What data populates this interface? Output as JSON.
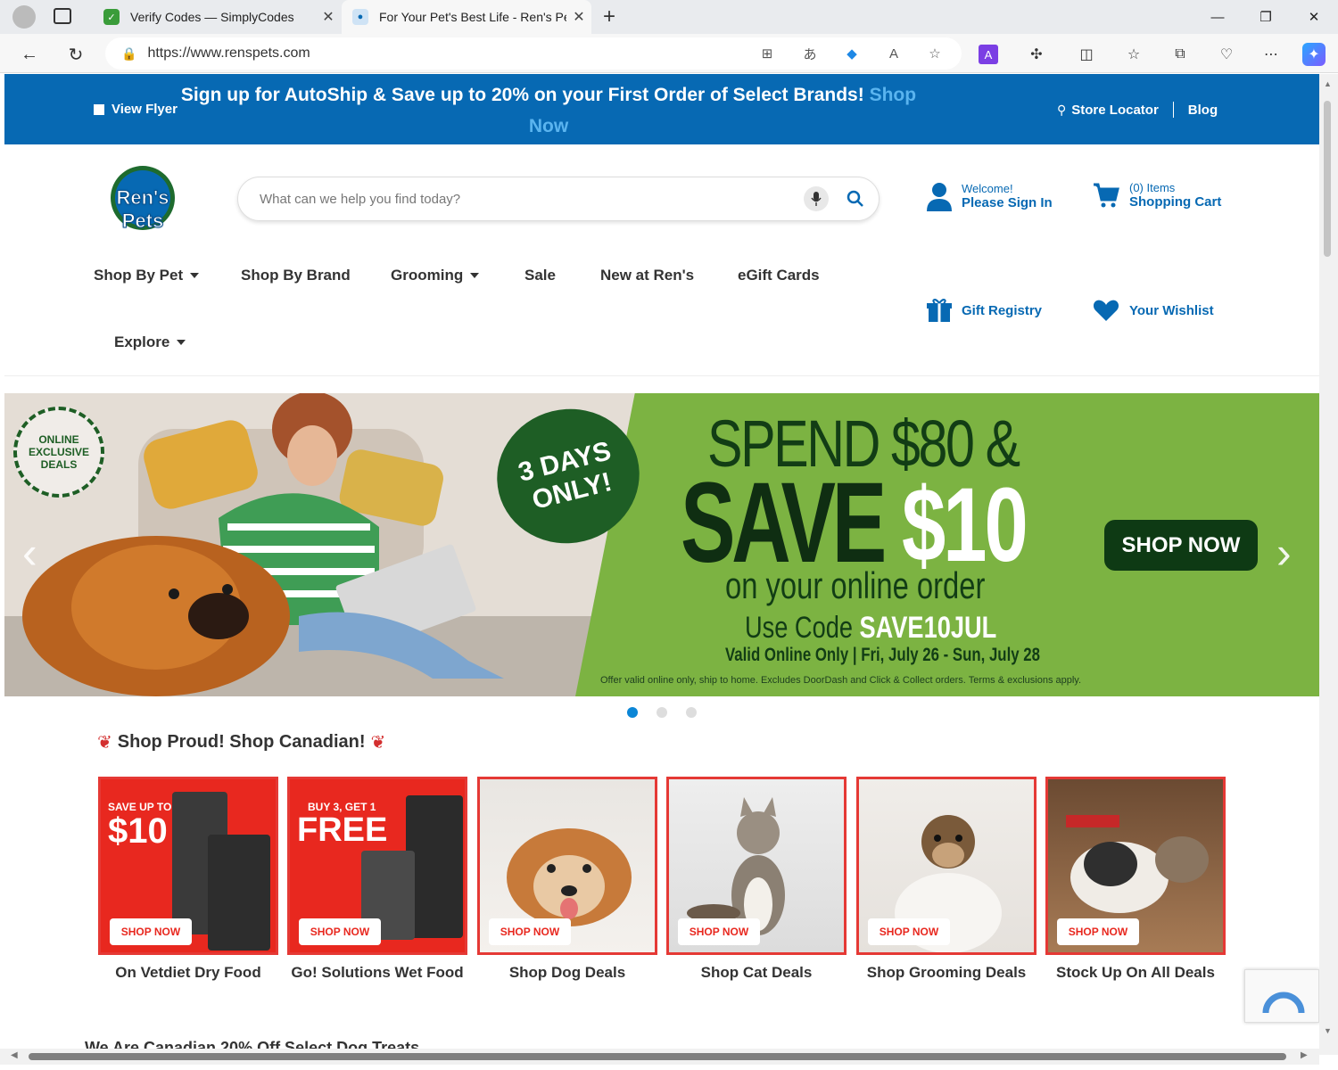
{
  "browser": {
    "tabs": [
      {
        "title": "Verify Codes — SimplyCodes",
        "active": false
      },
      {
        "title": "For Your Pet's Best Life - Ren's Pe",
        "active": true
      }
    ],
    "url": "https://www.renspets.com",
    "new_tab_glyph": "+",
    "close_glyph": "✕"
  },
  "promo_bar": {
    "view_flyer": "View Flyer",
    "message": "Sign up for AutoShip & Save up to 20% on your First Order of Select Brands!",
    "message_link": "Shop Now",
    "store_locator": "Store Locator",
    "blog": "Blog",
    "color": "#0769b3"
  },
  "header": {
    "logo_text": "Ren's Pets",
    "search_placeholder": "What can we help you find today?",
    "welcome": "Welcome!",
    "sign_in": "Please Sign In",
    "cart_count": "(0) Items",
    "cart_label": "Shopping Cart",
    "gift_registry": "Gift Registry",
    "wishlist": "Your Wishlist"
  },
  "nav": {
    "items": [
      "Shop By Pet",
      "Shop By Brand",
      "Grooming",
      "Sale",
      "New at Ren's",
      "eGift Cards"
    ],
    "explore": "Explore"
  },
  "hero": {
    "exclusive": "ONLINE EXCLUSIVE DEALS",
    "days": "3 DAYS ONLY!",
    "spend": "SPEND $80 &",
    "save": "SAVE",
    "amount": "$10",
    "on_order": "on your online order",
    "use_code": "Use Code",
    "code": "SAVE10JUL",
    "valid": "Valid Online Only | Fri, July 26 - Sun, July 28",
    "fine_print": "Offer valid online only, ship to home. Excludes DoorDash and Click & Collect orders. Terms & exclusions apply.",
    "shop_now": "SHOP NOW",
    "slide_count": 3,
    "active_slide": 1
  },
  "section": {
    "title": "Shop Proud! Shop Canadian!",
    "cards": [
      {
        "promo_top": "SAVE UP TO",
        "promo_big": "$10",
        "cta": "SHOP NOW",
        "caption": "On Vetdiet Dry Food"
      },
      {
        "promo_top": "BUY 3, GET 1",
        "promo_big": "FREE",
        "cta": "SHOP NOW",
        "caption": "Go! Solutions Wet Food"
      },
      {
        "cta": "SHOP NOW",
        "caption": "Shop Dog Deals"
      },
      {
        "cta": "SHOP NOW",
        "caption": "Shop Cat Deals"
      },
      {
        "cta": "SHOP NOW",
        "caption": "Shop Grooming Deals"
      },
      {
        "cta": "SHOP NOW",
        "caption": "Stock Up On All Deals"
      }
    ],
    "next_heading_partial": "We Are Canadian 20% Off Select Dog Treats"
  }
}
